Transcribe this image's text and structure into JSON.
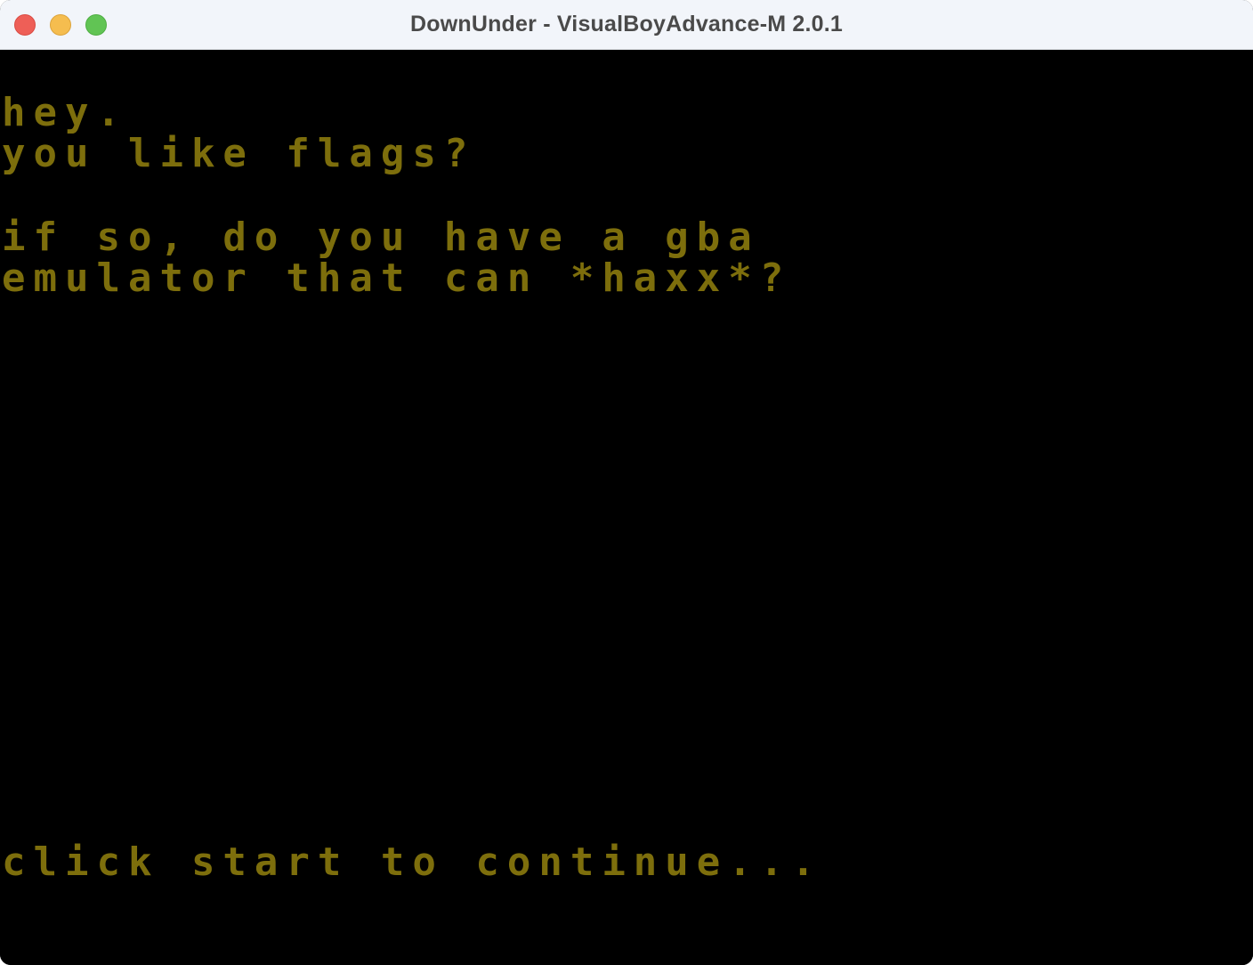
{
  "window": {
    "title": "DownUnder - VisualBoyAdvance-M 2.0.1",
    "controls": [
      "close",
      "minimize",
      "zoom"
    ]
  },
  "game": {
    "text_color": "#7d6e0c",
    "background_color": "#000000",
    "lines": [
      "hey.",
      "you like flags?",
      "if so, do you have a gba",
      "emulator that can *haxx*?",
      "click start to continue..."
    ]
  }
}
